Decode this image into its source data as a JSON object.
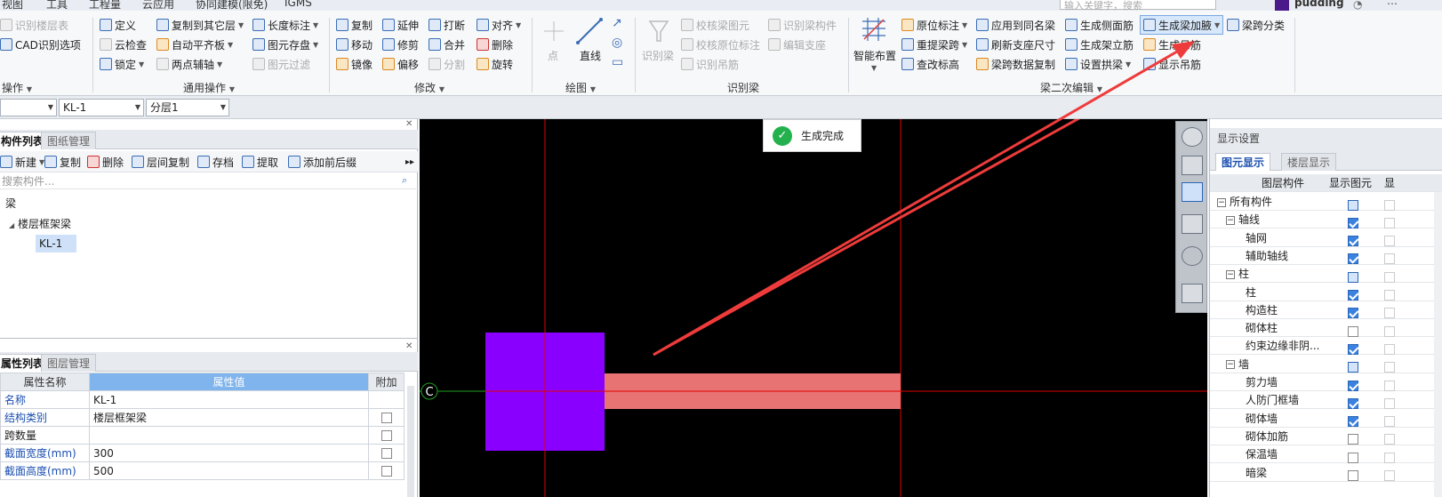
{
  "menubar": {
    "items": [
      "视图",
      "工具",
      "工程量",
      "云应用",
      "协同建模(限免)",
      "IGMS"
    ],
    "search_placeholder": "输入关键字，搜索",
    "user": "pudding"
  },
  "ribbon": {
    "groups": {
      "op": "操作",
      "common": "通用操作",
      "modify": "修改",
      "draw": "绘图",
      "recognize": "识别梁",
      "beam2": "梁二次编辑"
    },
    "col0": {
      "layer_table": "识别楼层表",
      "cad_options": "CAD识别选项"
    },
    "col1": {
      "define": "定义",
      "cloud_check": "云检查",
      "lock": "锁定"
    },
    "col2": {
      "copy_to_floor": "复制到其它层",
      "auto_align": "自动平齐板",
      "two_point_axis": "两点辅轴"
    },
    "col3": {
      "length_dim": "长度标注",
      "element_save": "图元存盘",
      "element_filter": "图元过滤"
    },
    "modify": {
      "copy": "复制",
      "move": "移动",
      "mirror": "镜像",
      "extend": "延伸",
      "trim": "修剪",
      "offset": "偏移",
      "break": "打断",
      "merge": "合并",
      "split": "分割",
      "align": "对齐",
      "delete": "删除",
      "rotate": "旋转"
    },
    "draw": {
      "point": "点",
      "line": "直线"
    },
    "recognize": {
      "recognize_beam": "识别梁",
      "check_beam": "校核梁图元",
      "check_orig": "校核原位标注",
      "recognize_hanger": "识别吊筋",
      "recognize_member": "识别梁构件",
      "edit_support": "编辑支座"
    },
    "beam2": {
      "smart_layout": "智能布置",
      "orig_label": "原位标注",
      "re_span": "重提梁跨",
      "check_elev": "查改标高",
      "apply_same": "应用到同名梁",
      "refresh_support": "刷新支座尺寸",
      "span_copy": "梁跨数据复制",
      "side_bar": "生成侧面筋",
      "erect_bar": "生成架立筋",
      "set_arch": "设置拱梁",
      "gen_haunch": "生成梁加腋",
      "gen_hanger": "生成吊筋",
      "show_hanger": "显示吊筋",
      "span_class": "梁跨分类"
    }
  },
  "selbar": {
    "floor": "",
    "component": "KL-1",
    "layer": "分层1"
  },
  "component_list": {
    "tabs": [
      "构件列表",
      "图纸管理"
    ],
    "tools": {
      "new": "新建",
      "copy": "复制",
      "delete": "删除",
      "floor_copy": "层间复制",
      "archive": "存档",
      "extract": "提取",
      "add_prefix": "添加前后缀"
    },
    "search_placeholder": "搜索构件...",
    "tree": {
      "root": "梁",
      "group": "楼层框架梁",
      "item": "KL-1"
    }
  },
  "property_list": {
    "tabs": [
      "属性列表",
      "图层管理"
    ],
    "headers": [
      "属性名称",
      "属性值",
      "附加"
    ],
    "rows": [
      {
        "name": "名称",
        "value": "KL-1",
        "check": false,
        "has_check": false,
        "blue": true
      },
      {
        "name": "结构类别",
        "value": "楼层框架梁",
        "check": false,
        "has_check": true,
        "blue": true
      },
      {
        "name": "跨数量",
        "value": "",
        "check": false,
        "has_check": true,
        "blue": false
      },
      {
        "name": "截面宽度(mm)",
        "value": "300",
        "check": false,
        "has_check": true,
        "blue": true
      },
      {
        "name": "截面高度(mm)",
        "value": "500",
        "check": false,
        "has_check": true,
        "blue": true
      }
    ]
  },
  "canvas": {
    "toast": "生成完成",
    "axis_label": "C"
  },
  "display_settings": {
    "title": "显示设置",
    "tabs": [
      "图元显示",
      "楼层显示"
    ],
    "headers": [
      "图层构件",
      "显示图元",
      "显"
    ],
    "rows": [
      {
        "label": "所有构件",
        "level": 0,
        "exp": true,
        "state": "part"
      },
      {
        "label": "轴线",
        "level": 1,
        "exp": true,
        "state": "on"
      },
      {
        "label": "轴网",
        "level": 2,
        "exp": false,
        "state": "on"
      },
      {
        "label": "辅助轴线",
        "level": 2,
        "exp": false,
        "state": "on"
      },
      {
        "label": "柱",
        "level": 1,
        "exp": true,
        "state": "part"
      },
      {
        "label": "柱",
        "level": 2,
        "exp": false,
        "state": "on"
      },
      {
        "label": "构造柱",
        "level": 2,
        "exp": false,
        "state": "on"
      },
      {
        "label": "砌体柱",
        "level": 2,
        "exp": false,
        "state": "off"
      },
      {
        "label": "约束边缘非阴...",
        "level": 2,
        "exp": false,
        "state": "on"
      },
      {
        "label": "墙",
        "level": 1,
        "exp": true,
        "state": "part"
      },
      {
        "label": "剪力墙",
        "level": 2,
        "exp": false,
        "state": "on"
      },
      {
        "label": "人防门框墙",
        "level": 2,
        "exp": false,
        "state": "on"
      },
      {
        "label": "砌体墙",
        "level": 2,
        "exp": false,
        "state": "on"
      },
      {
        "label": "砌体加筋",
        "level": 2,
        "exp": false,
        "state": "off"
      },
      {
        "label": "保温墙",
        "level": 2,
        "exp": false,
        "state": "off"
      },
      {
        "label": "暗梁",
        "level": 2,
        "exp": false,
        "state": "off"
      }
    ]
  },
  "colors": {
    "column": "#8a00ff",
    "beam": "#e87373",
    "axis": "#e00000",
    "arrow": "#ee3b3b",
    "accent": "#3b82e0"
  }
}
